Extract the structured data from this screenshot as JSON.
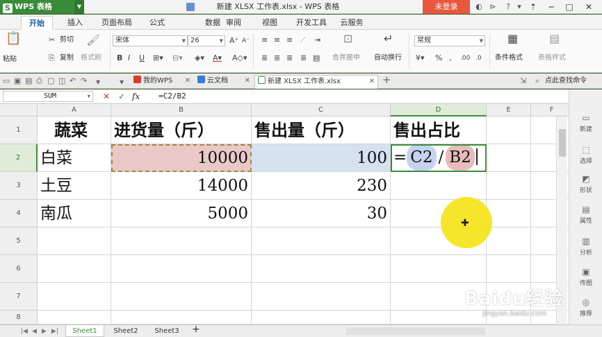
{
  "app": {
    "name": "WPS 表格",
    "logo_letter": "S",
    "window_title": "新建 XLSX 工作表.xlsx - WPS 表格",
    "login_label": "未登录"
  },
  "menu": {
    "tabs": [
      "开始",
      "插入",
      "页面布局",
      "公式",
      "数据",
      "审阅",
      "视图",
      "开发工具",
      "云服务"
    ],
    "active": "开始"
  },
  "ribbon": {
    "paste": "粘贴",
    "cut": "剪切",
    "copy": "复制",
    "format_painter": "格式刷",
    "font_name": "宋体",
    "font_size": "26",
    "merge_center": "合并居中",
    "wrap_text": "自动换行",
    "number_format": "常规",
    "conditional_format": "条件格式",
    "table_style": "表格样式"
  },
  "doc_tabs": {
    "my_wps": "我的WPS",
    "cloud_docs": "云文档",
    "file": "新建 XLSX 工作表.xlsx",
    "search": "点此查找命令"
  },
  "formula_bar": {
    "name_box": "SUM",
    "formula": "=C2/B2"
  },
  "grid": {
    "columns": [
      "A",
      "B",
      "C",
      "D",
      "E",
      "F"
    ],
    "rows": [
      "1",
      "2",
      "3",
      "4",
      "5",
      "6",
      "7",
      "8"
    ],
    "headers": [
      "蔬菜",
      "进货量（斤）",
      "售出量（斤）",
      "售出占比"
    ],
    "data": [
      [
        "白菜",
        "10000",
        "100"
      ],
      [
        "土豆",
        "14000",
        "230"
      ],
      [
        "南瓜",
        "5000",
        "30"
      ]
    ],
    "edit_cell": {
      "eq": "=",
      "ref1": "C2",
      "op": "/",
      "ref2": "B2"
    }
  },
  "side_panel": [
    "新建",
    "选择",
    "形状",
    "属性",
    "分析",
    "传图",
    "推荐"
  ],
  "sheets": [
    "Sheet1",
    "Sheet2",
    "Sheet3"
  ],
  "active_sheet": "Sheet1",
  "watermark": {
    "brand": "Baidu经验",
    "url": "jingyan.baidu.com"
  },
  "colors": {
    "wps_green": "#3a8c3a",
    "login_red": "#e9573f",
    "ref_b_fill": "#eac8c8",
    "ref_c_fill": "#d6e1f1",
    "highlight_yellow": "#f4e41a"
  }
}
